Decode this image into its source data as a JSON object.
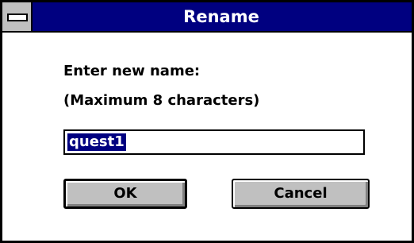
{
  "window": {
    "title": "Rename"
  },
  "prompt": {
    "line1": "Enter new name:",
    "line2": "(Maximum 8 characters)"
  },
  "name_field": {
    "value": "quest1"
  },
  "buttons": {
    "ok_label": "OK",
    "cancel_label": "Cancel"
  },
  "icons": {
    "system_menu": "system-menu-icon"
  },
  "colors": {
    "titlebar": "#000080",
    "button_face": "#c0c0c0",
    "selection": "#000080"
  }
}
